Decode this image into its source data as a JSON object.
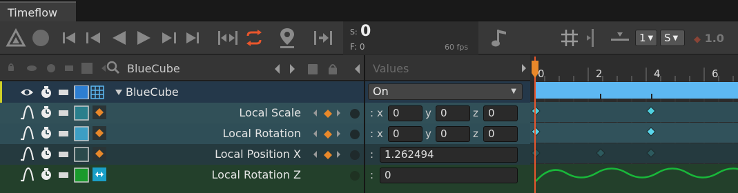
{
  "window": {
    "tab_title": "Timeflow"
  },
  "toolbar": {
    "frame_time_label": "S:",
    "frame_time_value": "0",
    "frame_label": "F:",
    "frame_value": "0",
    "fps": "60 fps",
    "layer_value": "1",
    "mode_value": "S",
    "weight_value": "1.0"
  },
  "outline": {
    "header_title": "BlueCube",
    "values_header": "Values"
  },
  "object": {
    "name": "BlueCube",
    "state_value": "On"
  },
  "tracks": [
    {
      "label": "Local Scale",
      "axes": [
        "x",
        "y",
        "z"
      ],
      "values": [
        "0",
        "0",
        "0"
      ],
      "color": "#2a7f8c"
    },
    {
      "label": "Local Rotation",
      "axes": [
        "x",
        "y",
        "z"
      ],
      "values": [
        "0",
        "0",
        "0"
      ],
      "color": "#3d9ec4"
    },
    {
      "label": "Local Position X",
      "values": [
        "1.262494"
      ],
      "color": "#2b4a4c"
    },
    {
      "label": "Local Rotation Z",
      "values": [
        "0"
      ],
      "color": "#1a9a2c"
    }
  ],
  "timeline": {
    "ruler_ticks": [
      "0",
      "2",
      "4",
      "6"
    ]
  },
  "colors": {
    "accent_orange": "#e8882a",
    "object_bar": "#5db8f2",
    "curve_green": "#19b83a",
    "key_cyan": "#4fd0e0"
  }
}
